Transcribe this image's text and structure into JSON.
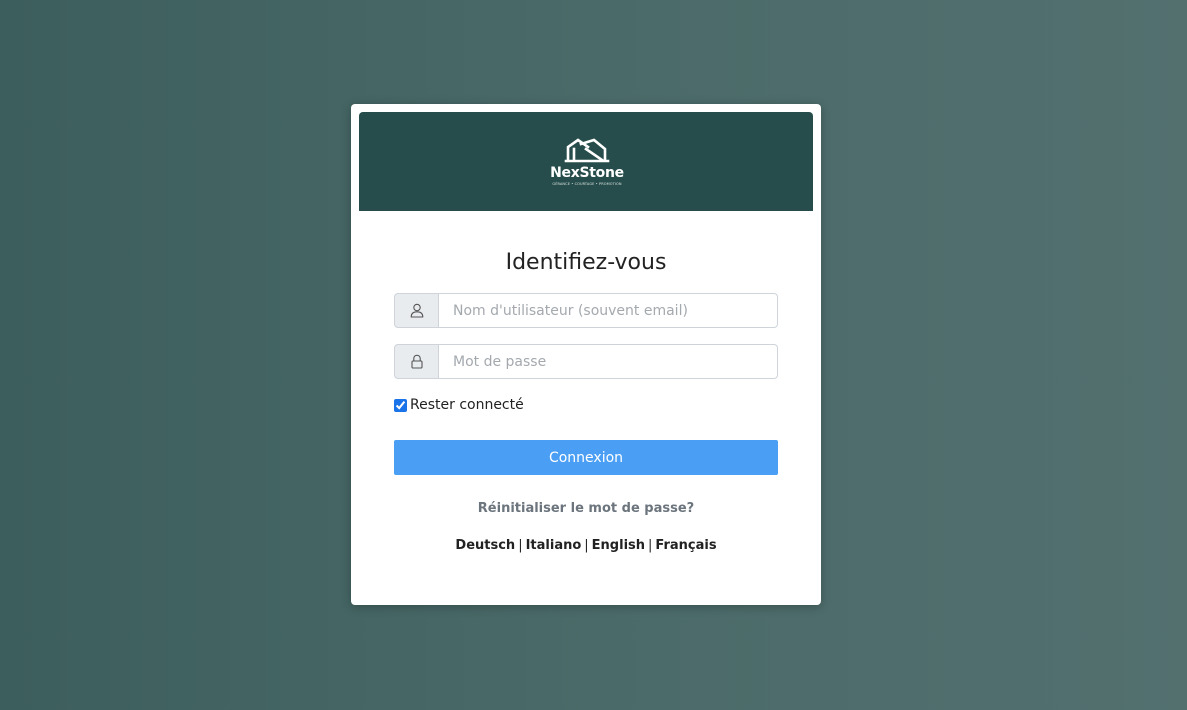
{
  "brand": {
    "name": "NexStone",
    "tagline": "GÉRANCE • COURTAGE • PROMOTION",
    "banner_color": "#264d4b"
  },
  "login": {
    "title": "Identifiez-vous",
    "username": {
      "placeholder": "Nom d'utilisateur (souvent email)",
      "value": "",
      "icon": "user-icon"
    },
    "password": {
      "placeholder": "Mot de passe",
      "value": "",
      "icon": "lock-icon"
    },
    "remember": {
      "label": "Rester connecté",
      "checked": true
    },
    "submit_label": "Connexion",
    "submit_color": "#4a9ff5",
    "reset_link": "Réinitialiser le mot de passe?"
  },
  "languages": [
    {
      "label": "Deutsch"
    },
    {
      "label": "Italiano"
    },
    {
      "label": "English"
    },
    {
      "label": "Français"
    }
  ],
  "language_separator": "|"
}
